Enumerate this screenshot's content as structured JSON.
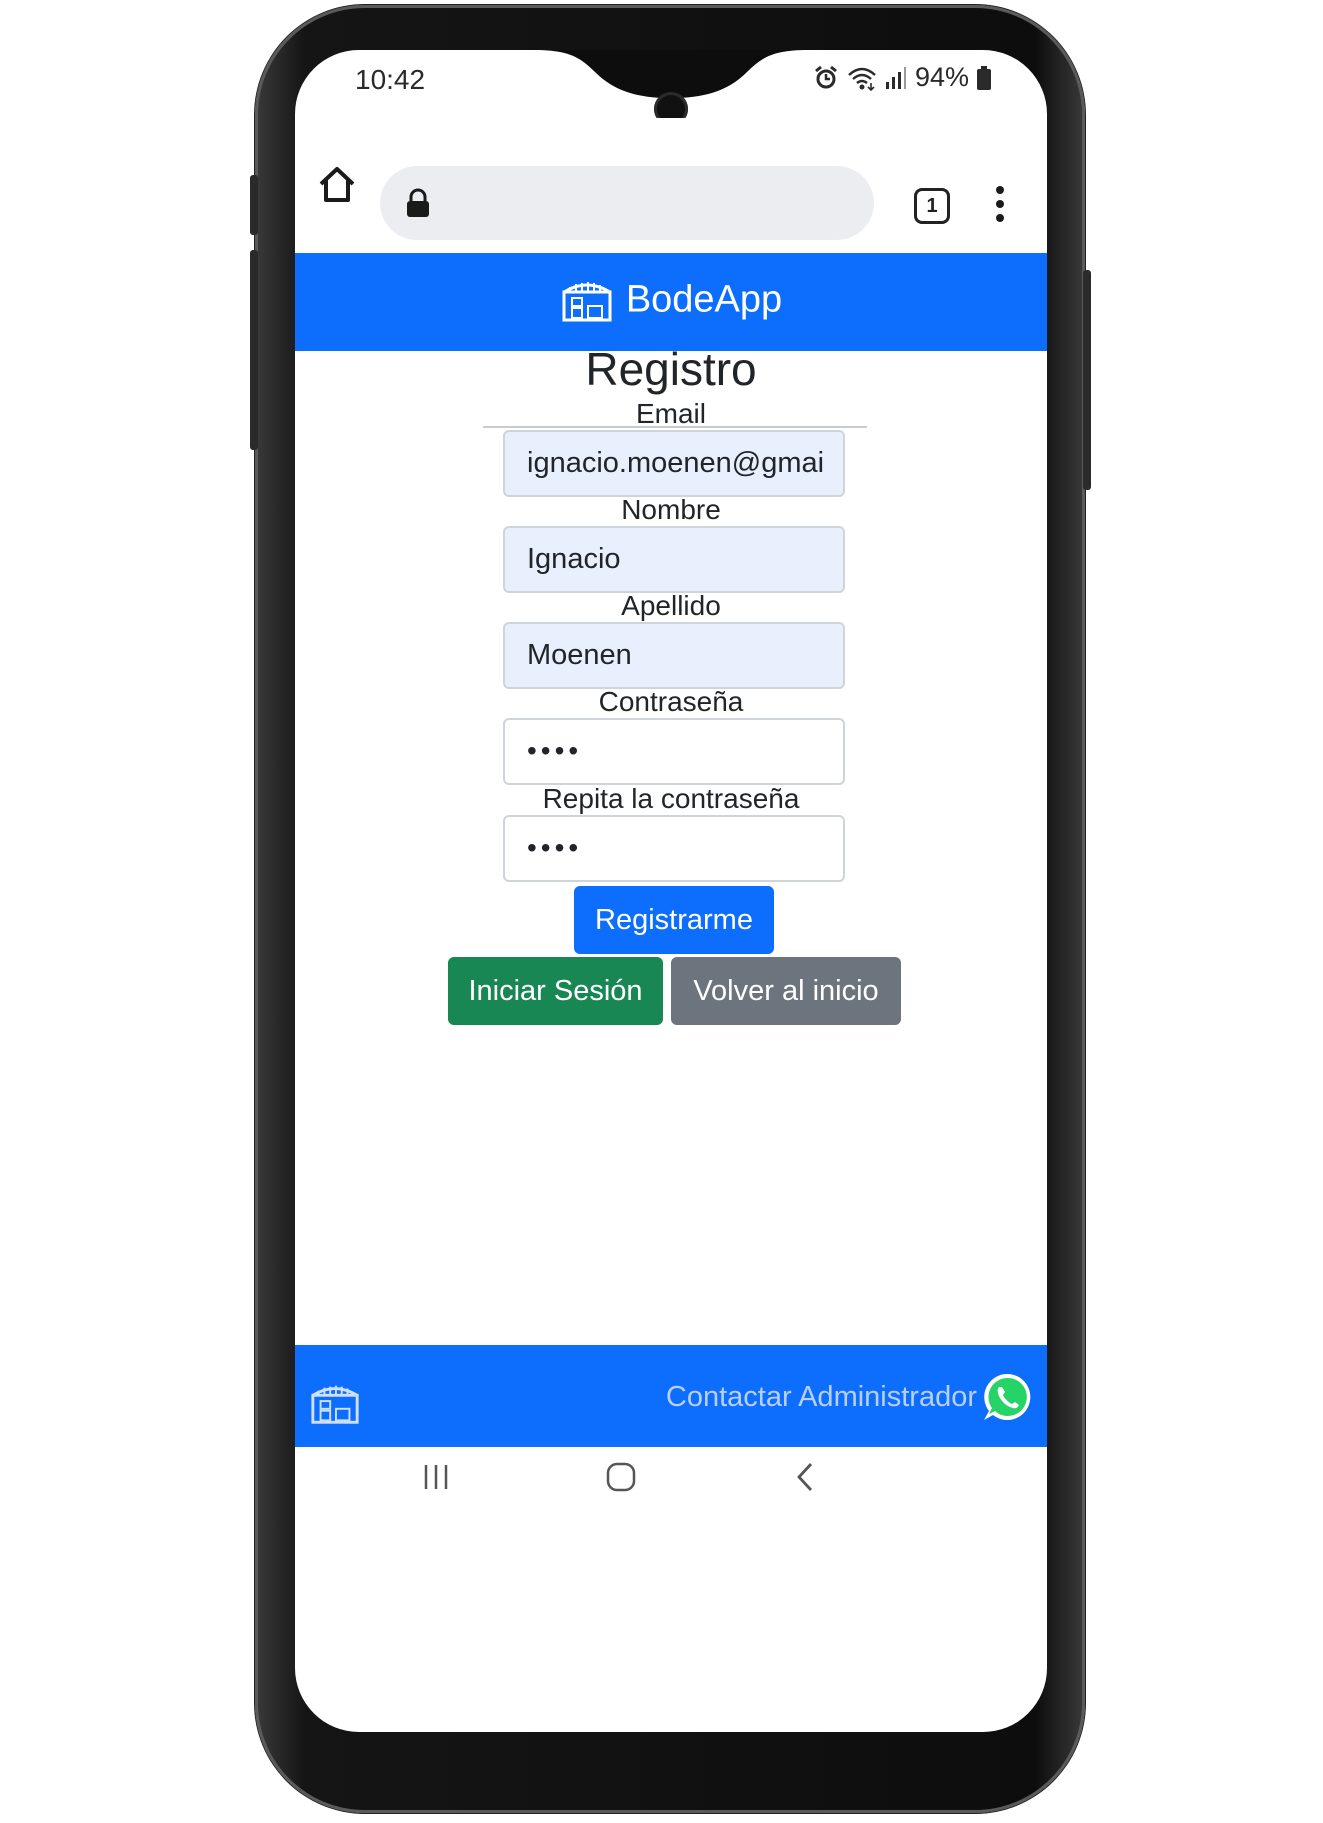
{
  "status_bar": {
    "time": "10:42",
    "battery": "94%",
    "icons": [
      "alarm-icon",
      "wifi-icon",
      "signal-icon",
      "battery-icon"
    ]
  },
  "browser": {
    "tab_count": "1",
    "icons": [
      "home-icon",
      "lock-icon",
      "tabs-icon",
      "menu-icon"
    ]
  },
  "navbar": {
    "brand": "BodeApp",
    "color": "#0d6efd"
  },
  "form": {
    "title": "Registro",
    "fields": [
      {
        "label": "Email",
        "value": "ignacio.moenen@gmai"
      },
      {
        "label": "Nombre",
        "value": "Ignacio"
      },
      {
        "label": "Apellido",
        "value": "Moenen"
      },
      {
        "label": "Contraseña",
        "value": "••••"
      },
      {
        "label": "Repita la contraseña",
        "value": "••••"
      }
    ],
    "register_button": "Registrarme",
    "login_button": "Iniciar Sesión",
    "back_button": "Volver al inicio"
  },
  "footer": {
    "contact_text": "Contactar Administrador",
    "icons": [
      "warehouse-icon",
      "whatsapp-icon"
    ]
  },
  "colors": {
    "primary": "#0d6efd",
    "success": "#198754",
    "secondary": "#6c757d"
  }
}
